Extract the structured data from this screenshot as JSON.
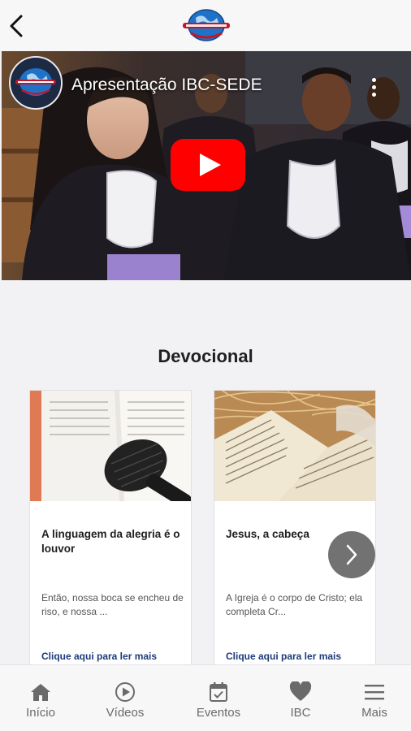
{
  "header": {
    "back_icon": "chevron-left-icon",
    "logo": "ibc-logo"
  },
  "video": {
    "title": "Apresentação IBC-SEDE",
    "play_icon": "youtube-play-icon",
    "menu_icon": "more-vert-icon",
    "play_color": "#ff0000"
  },
  "devocional": {
    "title": "Devocional",
    "cards": [
      {
        "title": "A linguagem da alegria é o louvor",
        "excerpt": "Então, nossa boca se encheu de riso, e nossa ...",
        "more": "Clique aqui para ler mais",
        "image": "microphone-on-bible"
      },
      {
        "title": "Jesus, a cabeça",
        "excerpt": "A Igreja é o corpo de Cristo; ela completa Cr...",
        "more": "Clique aqui para ler mais",
        "image": "open-bible-on-straw"
      }
    ],
    "next_icon": "chevron-right-icon"
  },
  "tabs": [
    {
      "label": "Início",
      "icon": "home-icon"
    },
    {
      "label": "Vídeos",
      "icon": "play-circle-icon"
    },
    {
      "label": "Eventos",
      "icon": "calendar-check-icon"
    },
    {
      "label": "IBC",
      "icon": "heart-icon"
    },
    {
      "label": "Mais",
      "icon": "menu-icon"
    }
  ],
  "colors": {
    "link": "#1c3a7a",
    "tab_icon": "#6a6a6a"
  }
}
